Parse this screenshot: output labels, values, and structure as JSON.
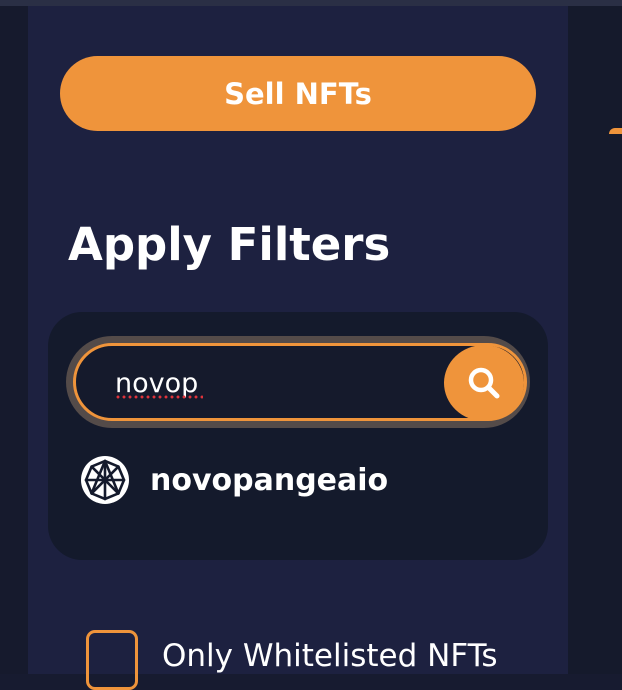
{
  "sidebar": {
    "sell_button_label": "Sell NFTs",
    "filters_title": "Apply Filters",
    "search": {
      "value": "novop",
      "placeholder": ""
    },
    "results": [
      {
        "label": "novopangeaio",
        "icon": "collection-logo-icon"
      }
    ],
    "whitelist_label": "Only Whitelisted NFTs"
  },
  "colors": {
    "accent": "#ef943b",
    "panel": "#1d2140",
    "card": "#141a2c"
  }
}
